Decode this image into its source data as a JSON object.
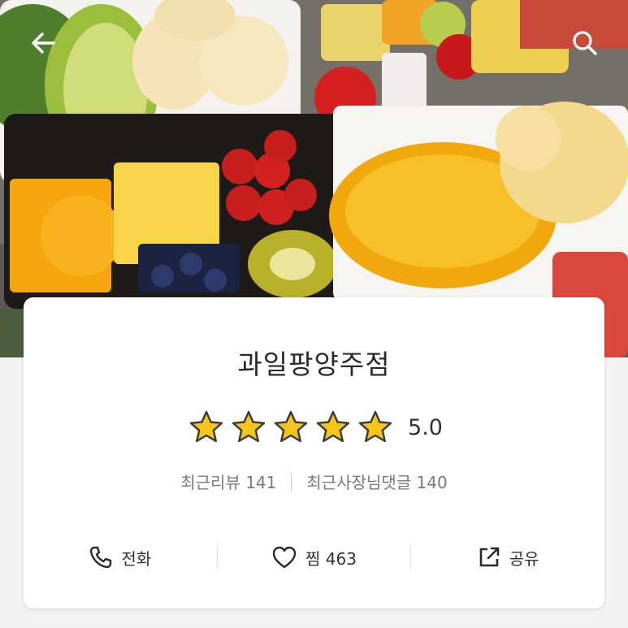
{
  "header": {
    "back_icon": "arrow-left-icon",
    "search_icon": "search-icon"
  },
  "store": {
    "name": "과일팡양주점",
    "rating": {
      "value": 5.0,
      "score_label": "5.0",
      "stars_filled": 5,
      "stars_total": 5
    },
    "reviews": {
      "recent_reviews_label": "최근리뷰 141",
      "owner_comments_label": "최근사장님댓글 140"
    }
  },
  "actions": [
    {
      "id": "call",
      "label": "전화",
      "icon": "phone-icon"
    },
    {
      "id": "favorite",
      "label": "찜 463",
      "icon": "heart-icon"
    },
    {
      "id": "share",
      "label": "공유",
      "icon": "share-icon"
    }
  ],
  "colors": {
    "star_fill": "#f5c518",
    "star_outline": "#3a3a3a",
    "card_bg": "#ffffff",
    "text_main": "#2a2a2a",
    "text_muted": "#7a7a7a"
  }
}
